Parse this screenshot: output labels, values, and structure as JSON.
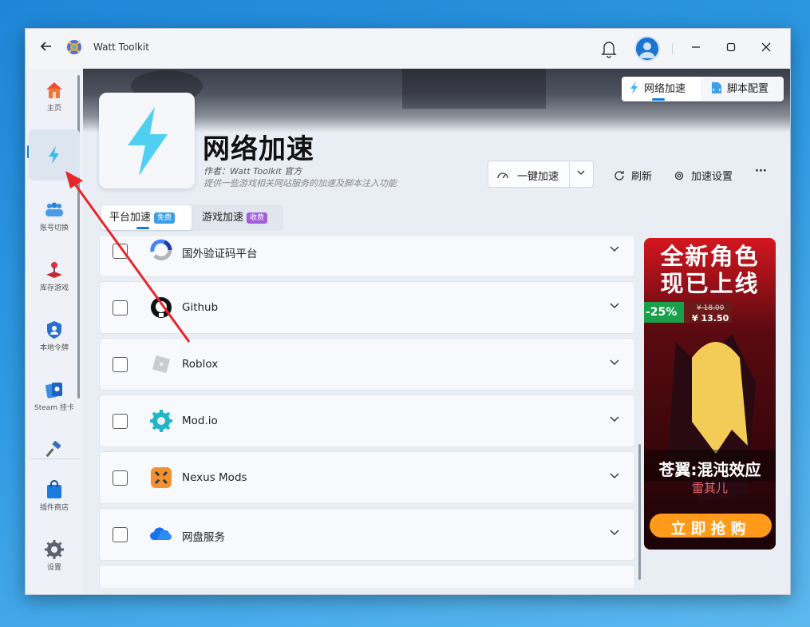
{
  "window": {
    "title": "Watt Toolkit"
  },
  "sidebar": {
    "items": [
      {
        "label": "主页"
      },
      {
        "label": ""
      },
      {
        "label": "账号切换"
      },
      {
        "label": "库存游戏"
      },
      {
        "label": "本地令牌"
      },
      {
        "label": "Steam 挂卡"
      },
      {
        "label": ""
      },
      {
        "label": "插件商店"
      },
      {
        "label": "设置"
      }
    ]
  },
  "top_tabs": [
    {
      "label": "网络加速"
    },
    {
      "label": "脚本配置"
    }
  ],
  "plugin": {
    "title": "网络加速",
    "author": "作者：Watt Toolkit 官方",
    "description": "提供一些游戏相关网站服务的加速及脚本注入功能"
  },
  "toolbar": {
    "speed_label": "一键加速",
    "refresh_label": "刷新",
    "settings_label": "加速设置",
    "more_label": "···"
  },
  "sub_tabs": [
    {
      "label": "平台加速",
      "badge": "免费"
    },
    {
      "label": "游戏加速",
      "badge": "收费"
    }
  ],
  "services": [
    {
      "name": "国外验证码平台"
    },
    {
      "name": "Github"
    },
    {
      "name": "Roblox"
    },
    {
      "name": "Mod.io"
    },
    {
      "name": "Nexus Mods"
    },
    {
      "name": "网盘服务"
    }
  ],
  "ad": {
    "headline1": "全新角色",
    "headline2": "现已上线",
    "discount": "-25%",
    "old_price": "¥ 18.00",
    "new_price": "¥ 13.50",
    "game_title": "苍翼:混沌效应",
    "character": "雷其儿",
    "cta": "立即抢购"
  },
  "colors": {
    "accent": "#1b7be0",
    "free_badge": "#3a9ee8",
    "paid_badge": "#a05fd6",
    "ad_red": "#c8151e",
    "ad_cta": "#ff9a1a",
    "arrow": "#e8262b"
  }
}
